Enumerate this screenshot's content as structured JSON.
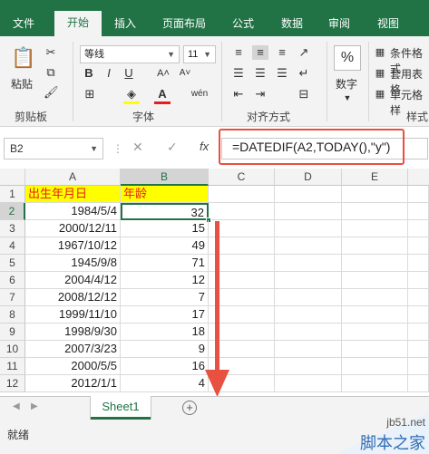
{
  "tabs": [
    "文件",
    "开始",
    "插入",
    "页面布局",
    "公式",
    "数据",
    "审阅",
    "视图"
  ],
  "ribbon": {
    "clipboard": {
      "paste": "粘贴",
      "group": "剪贴板"
    },
    "font": {
      "family": "等线",
      "size": "11",
      "group": "字体"
    },
    "alignment": {
      "group": "对齐方式"
    },
    "number": {
      "label": "数字",
      "percent_symbol": "%"
    },
    "styles": {
      "items": [
        "条件格式",
        "套用表格",
        "单元格样"
      ],
      "group": "样式"
    }
  },
  "formula_bar": {
    "name_box": "B2",
    "fx": "fx",
    "cancel": "✕",
    "enter": "✓",
    "formula": "=DATEDIF(A2,TODAY(),\"y\")"
  },
  "columns": [
    "A",
    "B",
    "C",
    "D",
    "E"
  ],
  "rows": [
    {
      "n": "1",
      "a": "出生年月日",
      "b": "年龄"
    },
    {
      "n": "2",
      "a": "1984/5/4",
      "b": "32"
    },
    {
      "n": "3",
      "a": "2000/12/11",
      "b": "15"
    },
    {
      "n": "4",
      "a": "1967/10/12",
      "b": "49"
    },
    {
      "n": "5",
      "a": "1945/9/8",
      "b": "71"
    },
    {
      "n": "6",
      "a": "2004/4/12",
      "b": "12"
    },
    {
      "n": "7",
      "a": "2008/12/12",
      "b": "7"
    },
    {
      "n": "8",
      "a": "1999/11/10",
      "b": "17"
    },
    {
      "n": "9",
      "a": "1998/9/30",
      "b": "18"
    },
    {
      "n": "10",
      "a": "2007/3/23",
      "b": "9"
    },
    {
      "n": "11",
      "a": "2000/5/5",
      "b": "16"
    },
    {
      "n": "12",
      "a": "2012/1/1",
      "b": "4"
    }
  ],
  "sheet": {
    "name": "Sheet1",
    "add": "+"
  },
  "status": "就绪",
  "watermark": {
    "site": "jb51.net",
    "brand": "脚本之家"
  },
  "colors": {
    "excel_green": "#217346",
    "highlight_red": "#e8503f",
    "header_yellow": "#ffff00"
  }
}
